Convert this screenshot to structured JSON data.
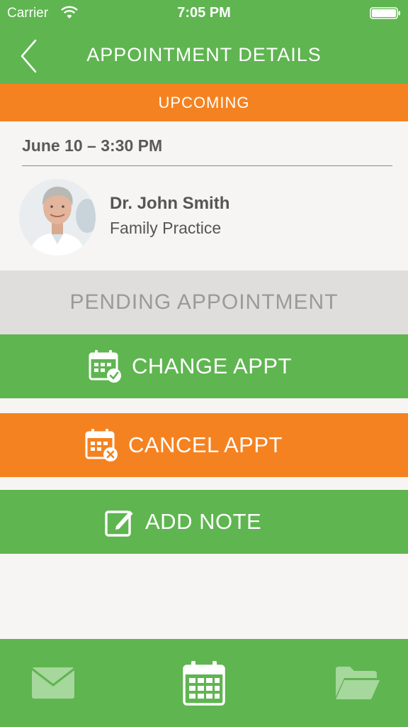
{
  "status_bar": {
    "carrier": "Carrier",
    "time": "7:05 PM"
  },
  "nav": {
    "title": "APPOINTMENT DETAILS"
  },
  "appointment": {
    "status": "UPCOMING",
    "datetime": "June 10 – 3:30 PM",
    "doctor_name": "Dr. John Smith",
    "doctor_specialty": "Family Practice",
    "banner": "PENDING APPOINTMENT"
  },
  "actions": {
    "change_label": "CHANGE APPT",
    "cancel_label": "CANCEL APPT",
    "note_label": "ADD NOTE"
  },
  "tabs": [
    {
      "icon": "mail-icon",
      "active": false
    },
    {
      "icon": "calendar-icon",
      "active": true
    },
    {
      "icon": "folder-icon",
      "active": false
    }
  ],
  "colors": {
    "green": "#5fb550",
    "orange": "#f58220",
    "banner_gray": "#dfdedc",
    "background": "#f6f5f3"
  }
}
